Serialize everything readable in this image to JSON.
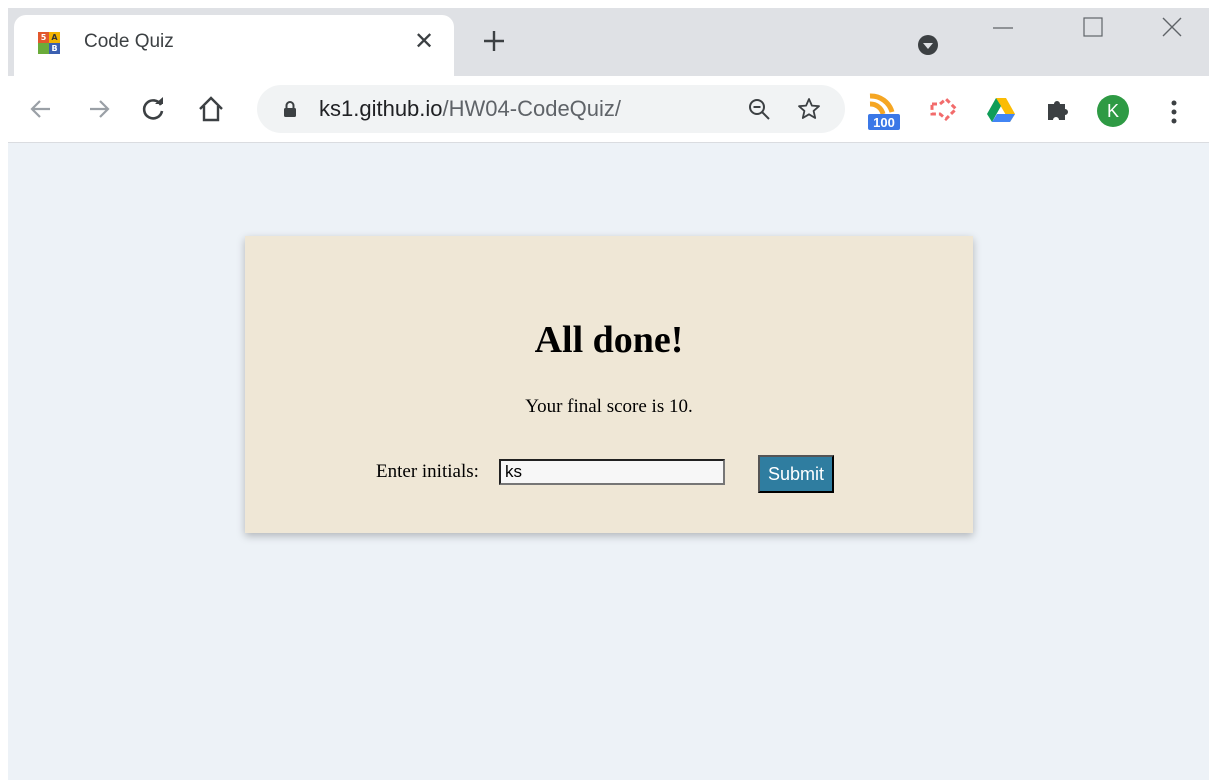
{
  "browser": {
    "tab": {
      "title": "Code Quiz",
      "close": "✕"
    },
    "url": {
      "host": "ks1.github.io",
      "path": "/HW04-CodeQuiz/"
    },
    "profile_initial": "K",
    "extension_badge": "100",
    "favicon_letters": [
      "5",
      "A",
      "",
      "B"
    ]
  },
  "page": {
    "heading": "All done!",
    "score_text": "Your final score is 10.",
    "initials_label": "Enter initials:",
    "initials_value": "ks",
    "submit_label": "Submit"
  },
  "colors": {
    "page_bg": "#edf2f7",
    "card_bg": "#efe7d6",
    "submit_bg": "#2f7da0",
    "avatar_bg": "#2e9a44"
  }
}
